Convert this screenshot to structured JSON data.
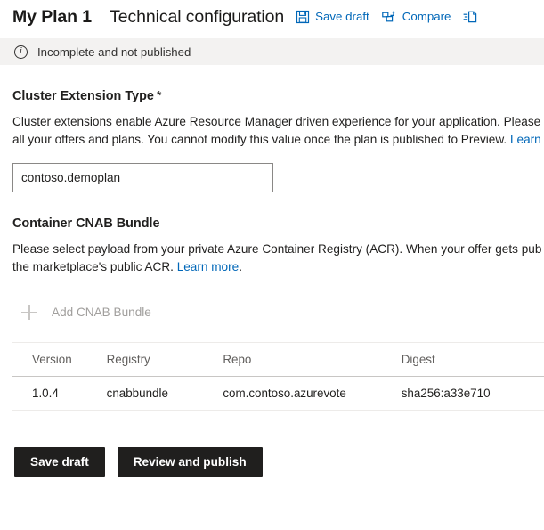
{
  "header": {
    "plan_title": "My Plan 1",
    "section_title": "Technical configuration",
    "commands": [
      {
        "label": "Save draft",
        "icon": "save-disk-icon"
      },
      {
        "label": "Compare",
        "icon": "compare-icon"
      },
      {
        "label": "",
        "icon": "page-document-icon"
      }
    ]
  },
  "status": {
    "icon": "info-circle-icon",
    "glyph": "i",
    "text": "Incomplete and not published"
  },
  "cluster_extension": {
    "label": "Cluster Extension Type",
    "required_marker": "*",
    "description_line1": "Cluster extensions enable Azure Resource Manager driven experience for your application. Please",
    "description_line2_pre": "all your offers and plans. You cannot modify this value once the plan is published to Preview. ",
    "description_line2_link": "Learn",
    "input_value": "contoso.demoplan",
    "input_placeholder": ""
  },
  "cnab": {
    "label": "Container CNAB Bundle",
    "description_line1": "Please select payload from your private Azure Container Registry (ACR). When your offer gets pub",
    "description_line2_pre": "the marketplace's public ACR. ",
    "description_line2_link": "Learn more",
    "description_line2_post": ".",
    "add_label": "Add CNAB Bundle",
    "add_icon": "plus-icon",
    "table": {
      "columns": [
        "Version",
        "Registry",
        "Repo",
        "Digest"
      ],
      "rows": [
        {
          "version": "1.0.4",
          "registry": "cnabbundle",
          "repo": "com.contoso.azurevote",
          "digest": "sha256:a33e710"
        }
      ]
    }
  },
  "footer": {
    "save_draft_label": "Save draft",
    "review_publish_label": "Review and publish"
  },
  "colors": {
    "link": "#0067b8",
    "status_bar_bg": "#f3f2f1",
    "button_bg": "#201f1e",
    "disabled_text": "#a19f9d"
  }
}
